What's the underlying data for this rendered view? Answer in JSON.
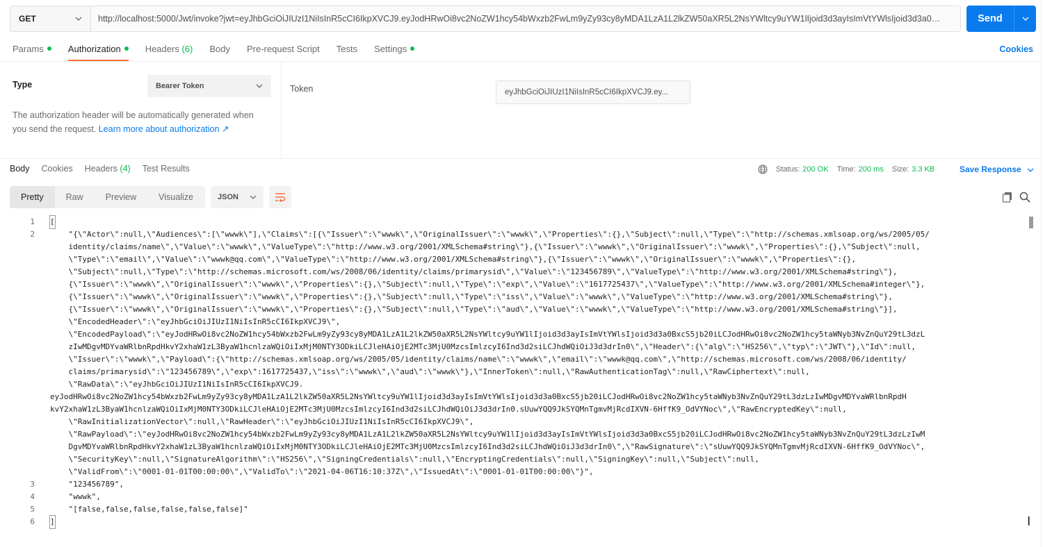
{
  "request": {
    "method": "GET",
    "url": "http://localhost:5000/Jwt/invoke?jwt=eyJhbGciOiJIUzI1NiIsInR5cCI6IkpXVCJ9.eyJodHRwOi8vc2NoZW1hcy54bWxzb2FwLm9yZy93cy8yMDA1LzA1L2lkZW50aXR5L2NsYWltcy9uYW1lIjoid3d3ayIsImVtYWlsIjoid3d3a0B:...",
    "send_label": "Send"
  },
  "request_tabs": [
    {
      "label": "Params",
      "dot": true
    },
    {
      "label": "Authorization",
      "dot": true,
      "active": true
    },
    {
      "label": "Headers",
      "count": "(6)"
    },
    {
      "label": "Body"
    },
    {
      "label": "Pre-request Script"
    },
    {
      "label": "Tests"
    },
    {
      "label": "Settings",
      "dot": true
    }
  ],
  "cookies_label": "Cookies",
  "auth": {
    "type_label": "Type",
    "type_value": "Bearer Token",
    "description": "The authorization header will be automatically generated when you send the request.",
    "learn_more": "Learn more about authorization ↗",
    "token_label": "Token",
    "token_value": "eyJhbGciOiJIUzI1NiIsInR5cCI6IkpXVCJ9.ey..."
  },
  "response_tabs": [
    {
      "label": "Body",
      "active": true
    },
    {
      "label": "Cookies"
    },
    {
      "label": "Headers",
      "count": "(4)"
    },
    {
      "label": "Test Results"
    }
  ],
  "status": {
    "status_label": "Status:",
    "status_value": "200 OK",
    "time_label": "Time:",
    "time_value": "200 ms",
    "size_label": "Size:",
    "size_value": "3.3 KB",
    "save_response": "Save Response"
  },
  "view_tabs": [
    "Pretty",
    "Raw",
    "Preview",
    "Visualize"
  ],
  "format": "JSON",
  "code_lines": [
    {
      "n": "1",
      "text": "["
    },
    {
      "n": "2",
      "text": "    \"{\\\"Actor\\\":null,\\\"Audiences\\\":[\\\"wwwk\\\"],\\\"Claims\\\":[{\\\"Issuer\\\":\\\"wwwk\\\",\\\"OriginalIssuer\\\":\\\"wwwk\\\",\\\"Properties\\\":{},\\\"Subject\\\":null,\\\"Type\\\":\\\"http://schemas.xmlsoap.org/ws/2005/05/"
    },
    {
      "n": "",
      "text": "    identity/claims/name\\\",\\\"Value\\\":\\\"wwwk\\\",\\\"ValueType\\\":\\\"http://www.w3.org/2001/XMLSchema#string\\\"},{\\\"Issuer\\\":\\\"wwwk\\\",\\\"OriginalIssuer\\\":\\\"wwwk\\\",\\\"Properties\\\":{},\\\"Subject\\\":null,"
    },
    {
      "n": "",
      "text": "    \\\"Type\\\":\\\"email\\\",\\\"Value\\\":\\\"wwwk@qq.com\\\",\\\"ValueType\\\":\\\"http://www.w3.org/2001/XMLSchema#string\\\"},{\\\"Issuer\\\":\\\"wwwk\\\",\\\"OriginalIssuer\\\":\\\"wwwk\\\",\\\"Properties\\\":{},"
    },
    {
      "n": "",
      "text": "    \\\"Subject\\\":null,\\\"Type\\\":\\\"http://schemas.microsoft.com/ws/2008/06/identity/claims/primarysid\\\",\\\"Value\\\":\\\"123456789\\\",\\\"ValueType\\\":\\\"http://www.w3.org/2001/XMLSchema#string\\\"},"
    },
    {
      "n": "",
      "text": "    {\\\"Issuer\\\":\\\"wwwk\\\",\\\"OriginalIssuer\\\":\\\"wwwk\\\",\\\"Properties\\\":{},\\\"Subject\\\":null,\\\"Type\\\":\\\"exp\\\",\\\"Value\\\":\\\"1617725437\\\",\\\"ValueType\\\":\\\"http://www.w3.org/2001/XMLSchema#integer\\\"},"
    },
    {
      "n": "",
      "text": "    {\\\"Issuer\\\":\\\"wwwk\\\",\\\"OriginalIssuer\\\":\\\"wwwk\\\",\\\"Properties\\\":{},\\\"Subject\\\":null,\\\"Type\\\":\\\"iss\\\",\\\"Value\\\":\\\"wwwk\\\",\\\"ValueType\\\":\\\"http://www.w3.org/2001/XMLSchema#string\\\"},"
    },
    {
      "n": "",
      "text": "    {\\\"Issuer\\\":\\\"wwwk\\\",\\\"OriginalIssuer\\\":\\\"wwwk\\\",\\\"Properties\\\":{},\\\"Subject\\\":null,\\\"Type\\\":\\\"aud\\\",\\\"Value\\\":\\\"wwwk\\\",\\\"ValueType\\\":\\\"http://www.w3.org/2001/XMLSchema#string\\\"}],"
    },
    {
      "n": "",
      "text": "    \\\"EncodedHeader\\\":\\\"eyJhbGciOiJIUzI1NiIsInR5cCI6IkpXVCJ9\\\","
    },
    {
      "n": "",
      "text": "    \\\"EncodedPayload\\\":\\\"eyJodHRwOi8vc2NoZW1hcy54bWxzb2FwLm9yZy93cy8yMDA1LzA1L2lkZW50aXR5L2NsYWltcy9uYW1lIjoid3d3ayIsImVtYWlsIjoid3d3a0BxcS5jb20iLCJodHRwOi8vc2NoZW1hcy5taWNyb3NvZnQuY29tL3dzL"
    },
    {
      "n": "",
      "text": "    zIwMDgvMDYvaWRlbnRpdHkvY2xhaW1zL3ByaW1hcnlzaWQiOiIxMjM0NTY3ODkiLCJleHAiOjE2MTc3MjU0MzcsImlzcyI6Ind3d2siLCJhdWQiOiJ3d3drIn0\\\",\\\"Header\\\":{\\\"alg\\\":\\\"HS256\\\",\\\"typ\\\":\\\"JWT\\\"},\\\"Id\\\":null,"
    },
    {
      "n": "",
      "text": "    \\\"Issuer\\\":\\\"wwwk\\\",\\\"Payload\\\":{\\\"http://schemas.xmlsoap.org/ws/2005/05/identity/claims/name\\\":\\\"wwwk\\\",\\\"email\\\":\\\"wwwk@qq.com\\\",\\\"http://schemas.microsoft.com/ws/2008/06/identity/"
    },
    {
      "n": "",
      "text": "    claims/primarysid\\\":\\\"123456789\\\",\\\"exp\\\":1617725437,\\\"iss\\\":\\\"wwwk\\\",\\\"aud\\\":\\\"wwwk\\\"},\\\"InnerToken\\\":null,\\\"RawAuthenticationTag\\\":null,\\\"RawCiphertext\\\":null,"
    },
    {
      "n": "",
      "text": "    \\\"RawData\\\":\\\"eyJhbGciOiJIUzI1NiIsInR5cCI6IkpXVCJ9."
    },
    {
      "n": "",
      "text": "eyJodHRwOi8vc2NoZW1hcy54bWxzb2FwLm9yZy93cy8yMDA1LzA1L2lkZW50aXR5L2NsYWltcy9uYW1lIjoid3d3ayIsImVtYWlsIjoid3d3a0BxcS5jb20iLCJodHRwOi8vc2NoZW1hcy5taWNyb3NvZnQuY29tL3dzLzIwMDgvMDYvaWRlbnRpdH"
    },
    {
      "n": "",
      "text": "kvY2xhaW1zL3ByaW1hcnlzaWQiOiIxMjM0NTY3ODkiLCJleHAiOjE2MTc3MjU0MzcsImlzcyI6Ind3d2siLCJhdWQiOiJ3d3drIn0.sUuwYQQ9JkSYQMnTgmvMjRcdIXVN-6HffK9_OdVYNoc\\\",\\\"RawEncryptedKey\\\":null,"
    },
    {
      "n": "",
      "text": "    \\\"RawInitializationVector\\\":null,\\\"RawHeader\\\":\\\"eyJhbGciOiJIUzI1NiIsInR5cCI6IkpXVCJ9\\\","
    },
    {
      "n": "",
      "text": "    \\\"RawPayload\\\":\\\"eyJodHRwOi8vc2NoZW1hcy54bWxzb2FwLm9yZy93cy8yMDA1LzA1L2lkZW50aXR5L2NsYWltcy9uYW1lIjoid3d3ayIsImVtYWlsIjoid3d3a0BxcS5jb20iLCJodHRwOi8vc2NoZW1hcy5taWNyb3NvZnQuY29tL3dzLzIwM"
    },
    {
      "n": "",
      "text": "    DgvMDYvaWRlbnRpdHkvY2xhaW1zL3ByaW1hcnlzaWQiOiIxMjM0NTY3ODkiLCJleHAiOjE2MTc3MjU0MzcsImlzcyI6Ind3d2siLCJhdWQiOiJ3d3drIn0\\\",\\\"RawSignature\\\":\\\"sUuwYQQ9JkSYQMnTgmvMjRcdIXVN-6HffK9_OdVYNoc\\\","
    },
    {
      "n": "",
      "text": "    \\\"SecurityKey\\\":null,\\\"SignatureAlgorithm\\\":\\\"HS256\\\",\\\"SigningCredentials\\\":null,\\\"EncryptingCredentials\\\":null,\\\"SigningKey\\\":null,\\\"Subject\\\":null,"
    },
    {
      "n": "",
      "text": "    \\\"ValidFrom\\\":\\\"0001-01-01T00:00:00\\\",\\\"ValidTo\\\":\\\"2021-04-06T16:10:37Z\\\",\\\"IssuedAt\\\":\\\"0001-01-01T00:00:00\\\"}\","
    },
    {
      "n": "3",
      "text": "    \"123456789\","
    },
    {
      "n": "4",
      "text": "    \"wwwk\","
    },
    {
      "n": "5",
      "text": "    \"[false,false,false,false,false,false]\""
    },
    {
      "n": "6",
      "text": "]"
    }
  ]
}
